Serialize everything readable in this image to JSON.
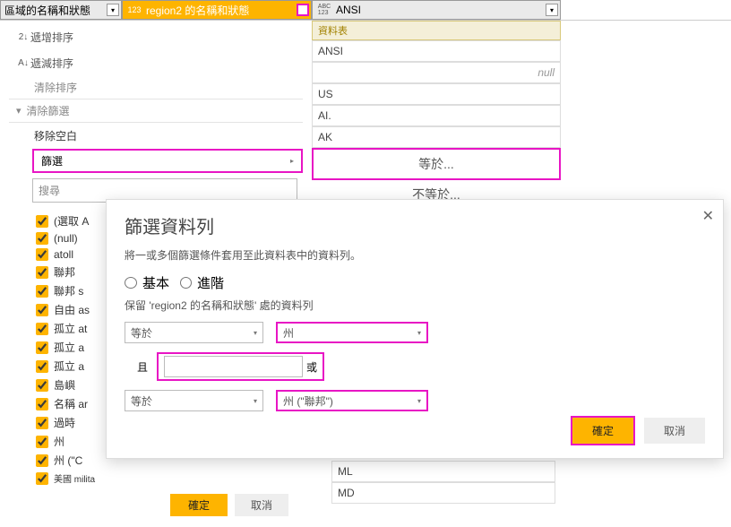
{
  "columns": {
    "col1_label": "區域的名稱和狀態",
    "col2_prefix": "123",
    "col2_label": "region2 的名稱和狀態",
    "col3_prefix": "ABC\n123",
    "col3_label": "ANSI"
  },
  "menu": {
    "sort_asc": "遞增排序",
    "sort_desc": "遞減排序",
    "clear_sort": "清除排序",
    "clear_filter": "清除篩選",
    "remove_blank": "移除空白",
    "filter_label": "篩選",
    "search_placeholder": "搜尋"
  },
  "check_items": [
    "(選取 A",
    "(null)",
    "atoll",
    "聯邦",
    "聯邦 s",
    "自由 as",
    "孤立 at",
    "孤立 a",
    "孤立 a",
    "島嶼",
    "名稱 ar",
    "過時",
    "州",
    "州 (\"C",
    "美國 milita"
  ],
  "btns": {
    "ok": "確定",
    "cancel": "取消"
  },
  "right_values": {
    "tab_header": "資料表",
    "row1": "ANSI",
    "row2_null": "null",
    "row3": "US",
    "row4": "AI.",
    "row5": "AK",
    "eq": "等於...",
    "neq": "不等於..."
  },
  "right_lower": {
    "row_a": "ML",
    "row_b": "MD"
  },
  "dialog": {
    "title": "篩選資料列",
    "desc": "將一或多個篩選條件套用至此資料表中的資料列。",
    "basic": "基本",
    "advanced": "進階",
    "keep": "保留 'region2 的名稱和狀態' 處的資料列",
    "op_eq": "等於",
    "val1": "州",
    "and": "且",
    "or": "或",
    "val2": "州 (\"聯邦\")",
    "ok": "確定",
    "cancel": "取消"
  }
}
